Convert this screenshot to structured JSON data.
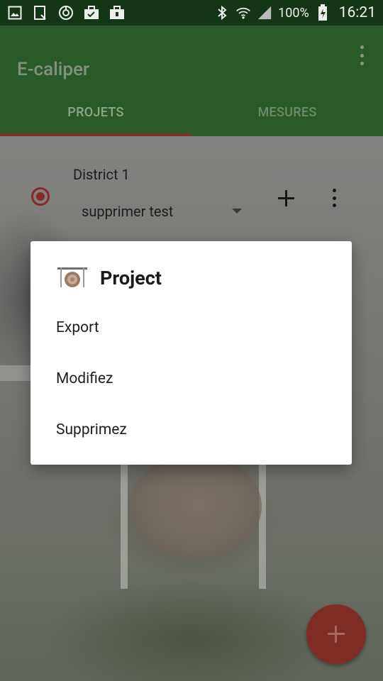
{
  "status_bar": {
    "battery_percent": "100%",
    "time": "16:21"
  },
  "app_bar": {
    "title": "E-caliper",
    "tabs": [
      {
        "label": "PROJETS",
        "active": true
      },
      {
        "label": "MESURES",
        "active": false
      }
    ]
  },
  "project_row": {
    "district": "District 1",
    "selected_project": "supprimer test"
  },
  "dialog": {
    "title": "Project",
    "items": [
      "Export",
      "Modifiez",
      "Supprimez"
    ]
  },
  "colors": {
    "status_bar": "#143516",
    "app_bar_dimmed": "#2a5a2a",
    "accent_red": "#852a28",
    "fab_dimmed": "#7f2b26",
    "dialog_bg": "#ffffff"
  },
  "icons": {
    "status_left": [
      "gallery-icon",
      "clipboard-icon",
      "sync-icon",
      "briefcase-icon",
      "briefcase-icon"
    ],
    "status_right": [
      "bluetooth-icon",
      "wifi-icon",
      "signal-icon",
      "battery-charging-icon"
    ],
    "dialog": "caliper-stump-icon",
    "fab": "add-icon"
  }
}
